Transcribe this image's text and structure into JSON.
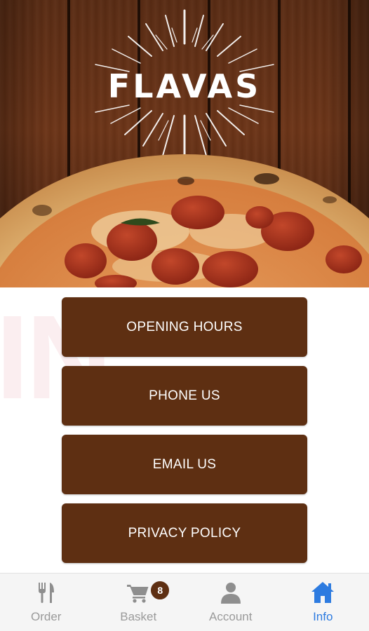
{
  "brand": {
    "logo_text": "FLAVAS"
  },
  "watermark": {
    "text": "IN"
  },
  "menu": {
    "opening_hours": "OPENING HOURS",
    "phone_us": "PHONE US",
    "email_us": "EMAIL US",
    "privacy_policy": "PRIVACY POLICY"
  },
  "bottom_nav": {
    "order": {
      "label": "Order",
      "icon": "fork-knife-icon"
    },
    "basket": {
      "label": "Basket",
      "icon": "cart-icon",
      "badge": "8"
    },
    "account": {
      "label": "Account",
      "icon": "person-icon"
    },
    "info": {
      "label": "Info",
      "icon": "home-icon",
      "active": true
    }
  },
  "colors": {
    "button_bg": "#5e2f12",
    "active_nav": "#2d7be0",
    "inactive_nav": "#9a9a9a"
  }
}
